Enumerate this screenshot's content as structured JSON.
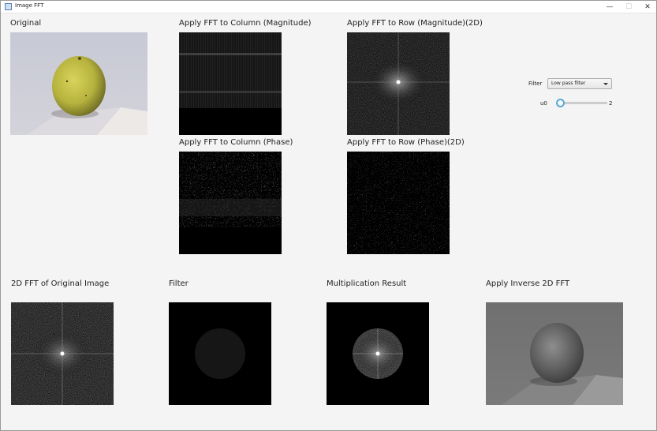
{
  "window": {
    "title": "Image FFT",
    "minimize": "—",
    "maximize": "☐",
    "close": "✕"
  },
  "panels": {
    "original": "Original",
    "col_mag": "Apply FFT to Column (Magnitude)",
    "row_mag": "Apply FFT to Row (Magnitude)(2D)",
    "col_phase": "Apply FFT to Column (Phase)",
    "row_phase": "Apply FFT to Row (Phase)(2D)",
    "fft2d": "2D FFT of Original Image",
    "filter": "Filter",
    "mult": "Multiplication Result",
    "inverse": "Apply Inverse 2D FFT"
  },
  "controls": {
    "filter_label": "Filter",
    "filter_value": "Low pass filter",
    "u0_label": "u0",
    "u0_value": "2"
  },
  "colors": {
    "slider_accent": "#55a9d8",
    "apple_yellow": "#b6b33e"
  }
}
